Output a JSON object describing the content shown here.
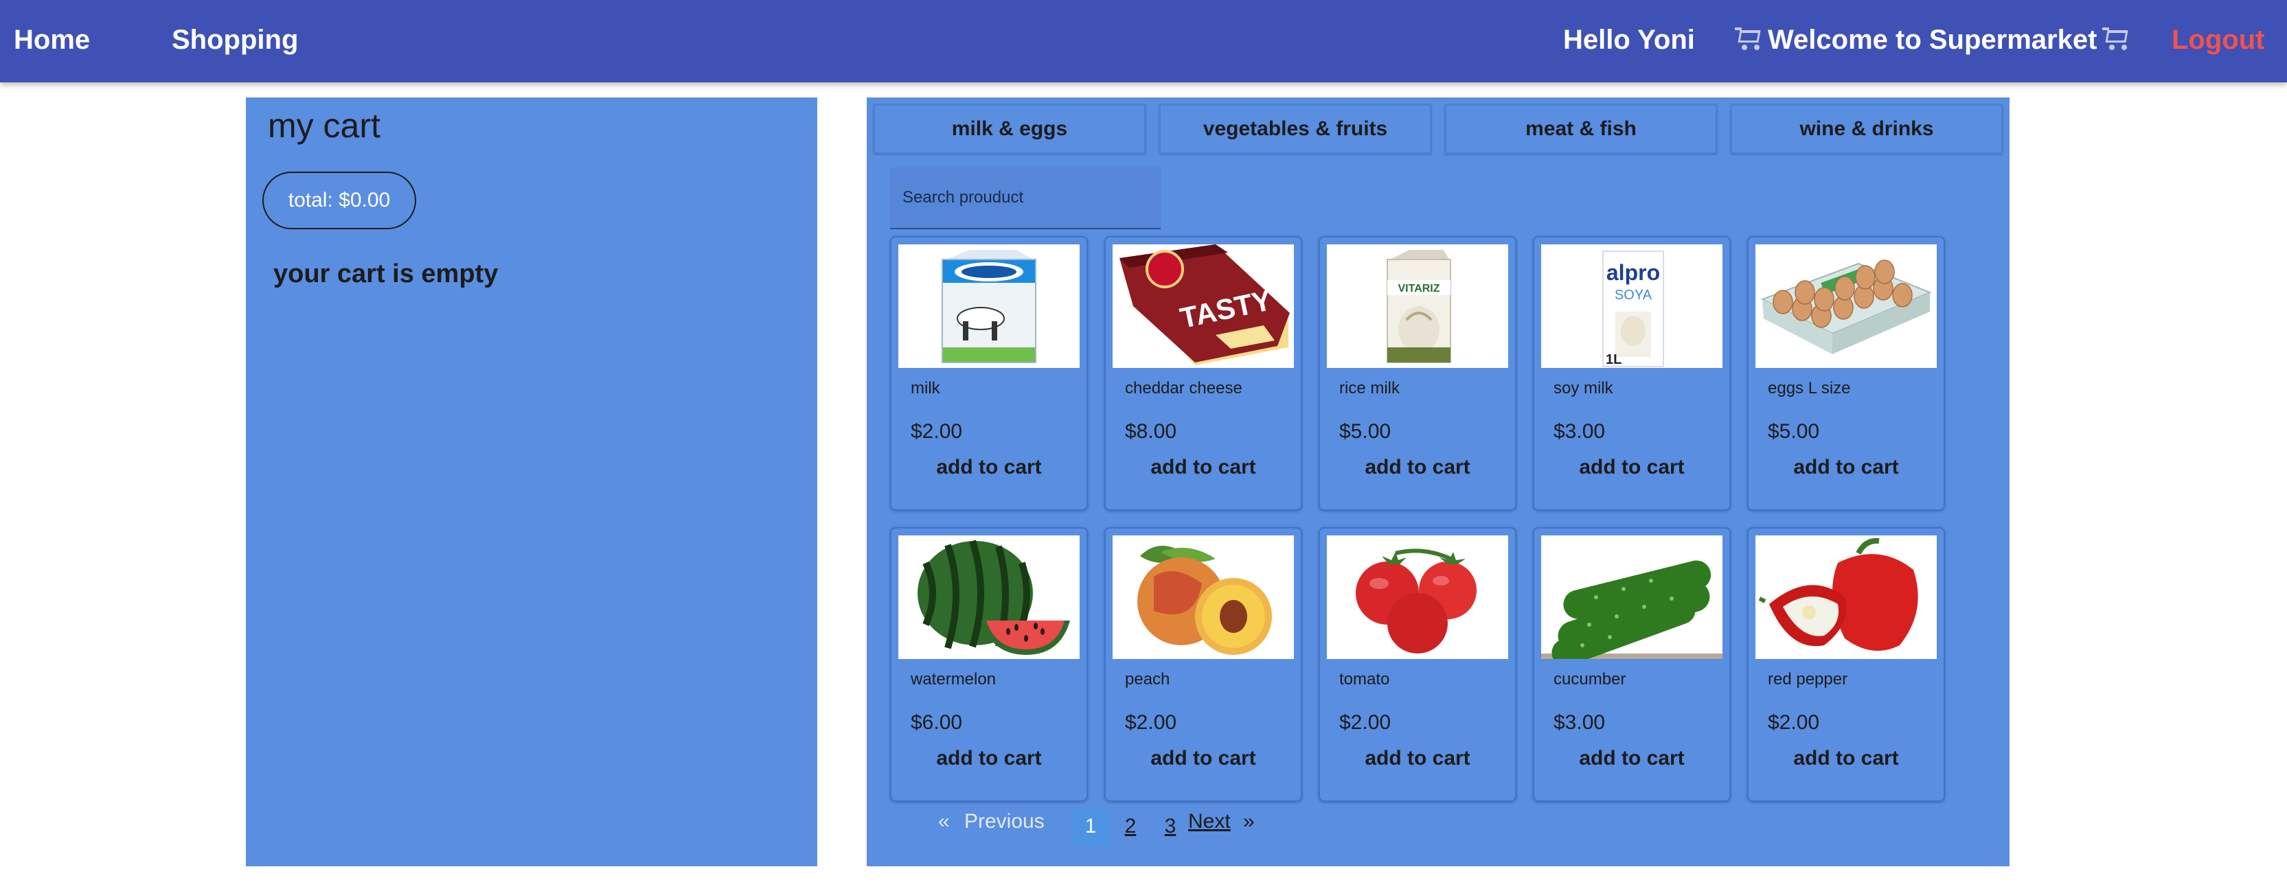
{
  "nav": {
    "home": "Home",
    "shopping": "Shopping",
    "greeting": "Hello Yoni",
    "welcome": "Welcome to Supermarket",
    "welcome_icon": "shopping-cart-icon",
    "logout": "Logout"
  },
  "cart": {
    "title": "my cart",
    "total": "total: $0.00",
    "empty_message": "your cart is empty"
  },
  "categories": [
    "milk & eggs",
    "vegetables & fruits",
    "meat & fish",
    "wine & drinks"
  ],
  "search": {
    "placeholder": "Search prouduct"
  },
  "products": [
    {
      "name": "milk",
      "price": "$2.00",
      "add_label": "add to cart"
    },
    {
      "name": "cheddar cheese",
      "price": "$8.00",
      "add_label": "add to cart"
    },
    {
      "name": "rice milk",
      "price": "$5.00",
      "add_label": "add to cart"
    },
    {
      "name": "soy milk",
      "price": "$3.00",
      "add_label": "add to cart"
    },
    {
      "name": "eggs L size",
      "price": "$5.00",
      "add_label": "add to cart"
    },
    {
      "name": "watermelon",
      "price": "$6.00",
      "add_label": "add to cart"
    },
    {
      "name": "peach",
      "price": "$2.00",
      "add_label": "add to cart"
    },
    {
      "name": "tomato",
      "price": "$2.00",
      "add_label": "add to cart"
    },
    {
      "name": "cucumber",
      "price": "$3.00",
      "add_label": "add to cart"
    },
    {
      "name": "red pepper",
      "price": "$2.00",
      "add_label": "add to cart"
    }
  ],
  "product_art": {
    "pack_brand": "TASTY",
    "soy_brand": "alpro",
    "soy_sub": "SOYA",
    "soy_size": "1L",
    "rice_brand": "VITARIZ"
  },
  "pagination": {
    "prev_arrow": "«",
    "prev": "Previous",
    "pages": [
      "1",
      "2",
      "3"
    ],
    "current": "1",
    "next": "Next",
    "next_arrow": "»"
  },
  "colors": {
    "navbar": "#3f51b5",
    "panel": "#5a8ee0",
    "logout": "#ef5350",
    "active_page": "#4d93e4"
  }
}
